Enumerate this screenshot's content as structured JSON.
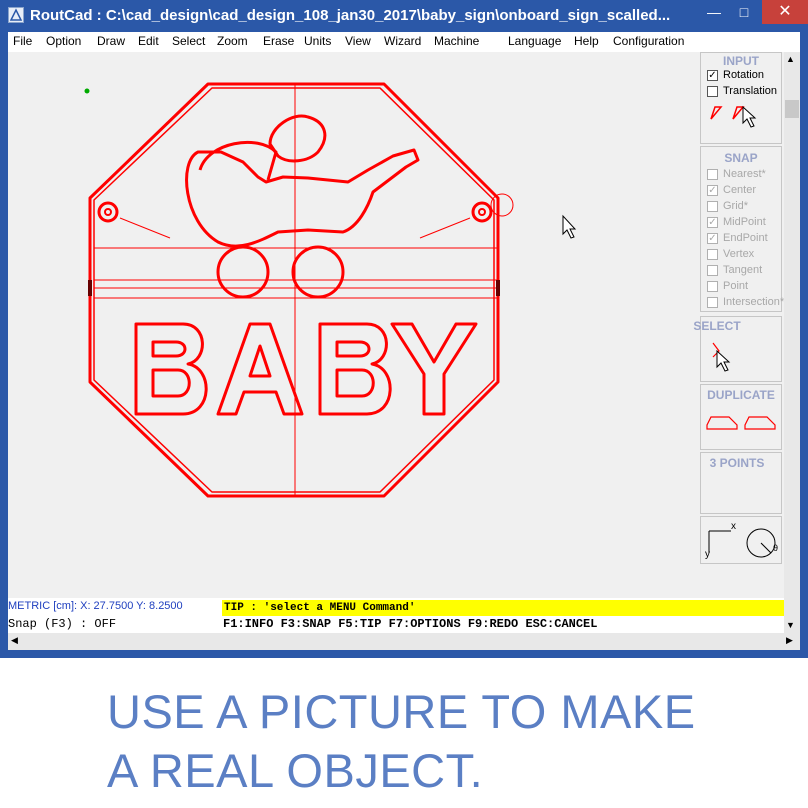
{
  "window": {
    "title": "RoutCad : C:\\cad_design\\cad_design_108_jan30_2017\\baby_sign\\onboard_sign_scalled...",
    "minimize_symbol": "—",
    "maximize_symbol": "□",
    "close_symbol": "✕"
  },
  "menu": [
    "File",
    "Option",
    "Draw",
    "Edit",
    "Select",
    "Zoom",
    "Erase",
    "Units",
    "View",
    "Wizard",
    "Machine",
    "Language",
    "Help",
    "Configuration"
  ],
  "drawing": {
    "sign_text": "BABY",
    "stroke_color": "#ff0000",
    "marker_color": "#00aa00"
  },
  "panel": {
    "input": {
      "title": "INPUT",
      "options": [
        {
          "label": "Rotation",
          "checked": true
        },
        {
          "label": "Translation",
          "checked": false
        }
      ]
    },
    "snap": {
      "title": "SNAP",
      "options": [
        {
          "label": "Nearest*",
          "checked": false
        },
        {
          "label": "Center",
          "checked": true
        },
        {
          "label": "Grid*",
          "checked": false
        },
        {
          "label": "MidPoint",
          "checked": true
        },
        {
          "label": "EndPoint",
          "checked": true
        },
        {
          "label": "Vertex",
          "checked": false
        },
        {
          "label": "Tangent",
          "checked": false
        },
        {
          "label": "Point",
          "checked": false
        },
        {
          "label": "Intersection*",
          "checked": false
        }
      ]
    },
    "select": {
      "title": "SELECT"
    },
    "duplicate": {
      "title": "DUPLICATE"
    },
    "three_points": {
      "title": "3 POINTS"
    },
    "axes": {
      "x_label": "x",
      "y_label": "y",
      "theta_label": "θ"
    }
  },
  "status": {
    "coords": "METRIC [cm]: X: 27.7500  Y: 8.2500",
    "snap": "Snap (F3) : OFF",
    "tip": "TIP : 'select a MENU Command'",
    "shortcuts": "F1:INFO  F3:SNAP  F5:TIP  F7:OPTIONS  F9:REDO  ESC:CANCEL"
  },
  "caption": {
    "line1": "USE A PICTURE TO MAKE",
    "line2": "A REAL OBJECT."
  },
  "colors": {
    "titlebar": "#2b58a8",
    "tip_background": "#ffff00",
    "caption": "#5b7fc4",
    "panel_title": "#9aa4c8"
  }
}
